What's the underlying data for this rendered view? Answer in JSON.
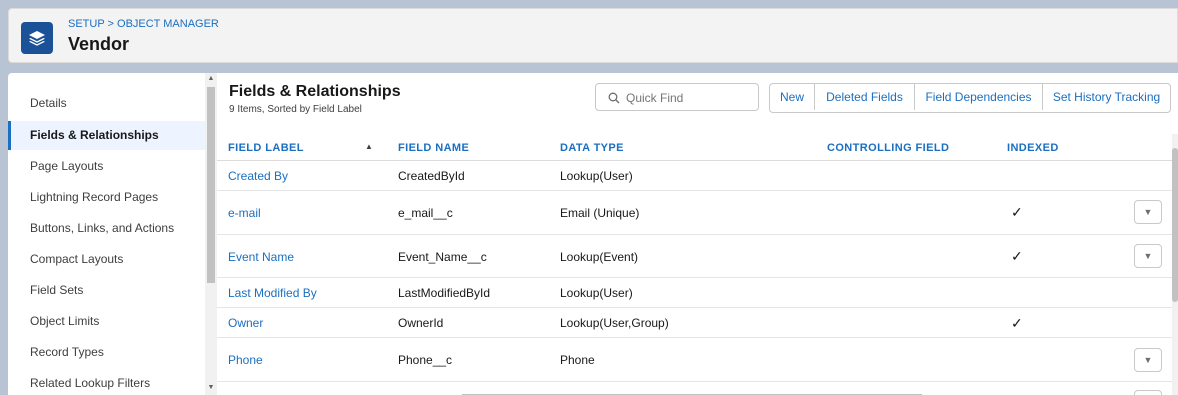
{
  "header": {
    "breadcrumb": "SETUP > OBJECT MANAGER",
    "title": "Vendor"
  },
  "sidebar": {
    "items": [
      {
        "label": "Details"
      },
      {
        "label": "Fields & Relationships"
      },
      {
        "label": "Page Layouts"
      },
      {
        "label": "Lightning Record Pages"
      },
      {
        "label": "Buttons, Links, and Actions"
      },
      {
        "label": "Compact Layouts"
      },
      {
        "label": "Field Sets"
      },
      {
        "label": "Object Limits"
      },
      {
        "label": "Record Types"
      },
      {
        "label": "Related Lookup Filters"
      }
    ],
    "active_index": 1
  },
  "section": {
    "title": "Fields & Relationships",
    "subtitle": "9 Items, Sorted by Field Label"
  },
  "toolbar": {
    "search_placeholder": "Quick Find",
    "new_label": "New",
    "deleted_fields_label": "Deleted Fields",
    "field_dependencies_label": "Field Dependencies",
    "set_history_tracking_label": "Set History Tracking"
  },
  "table": {
    "columns": {
      "field_label": "FIELD LABEL",
      "field_name": "FIELD NAME",
      "data_type": "DATA TYPE",
      "controlling_field": "CONTROLLING FIELD",
      "indexed": "INDEXED"
    },
    "rows": [
      {
        "label": "Created By",
        "name": "CreatedById",
        "type": "Lookup(User)",
        "controlling": "",
        "indexed": "",
        "menu": false
      },
      {
        "label": "e-mail",
        "name": "e_mail__c",
        "type": "Email (Unique)",
        "controlling": "",
        "indexed": "✓",
        "menu": true
      },
      {
        "label": "Event Name",
        "name": "Event_Name__c",
        "type": "Lookup(Event)",
        "controlling": "",
        "indexed": "✓",
        "menu": true
      },
      {
        "label": "Last Modified By",
        "name": "LastModifiedById",
        "type": "Lookup(User)",
        "controlling": "",
        "indexed": "",
        "menu": false
      },
      {
        "label": "Owner",
        "name": "OwnerId",
        "type": "Lookup(User,Group)",
        "controlling": "",
        "indexed": "✓",
        "menu": false
      },
      {
        "label": "Phone",
        "name": "Phone__c",
        "type": "Phone",
        "controlling": "",
        "indexed": "",
        "menu": true
      }
    ]
  },
  "icons": {
    "object": "stack-layers-icon",
    "search": "search-icon",
    "sort": "sort-ascending-icon",
    "row_menu": "chevron-down-icon",
    "check": "checkmark-icon"
  },
  "colors": {
    "brand": "#1b5297",
    "link": "#1b6fc1",
    "active_bg": "#eef4ff"
  }
}
